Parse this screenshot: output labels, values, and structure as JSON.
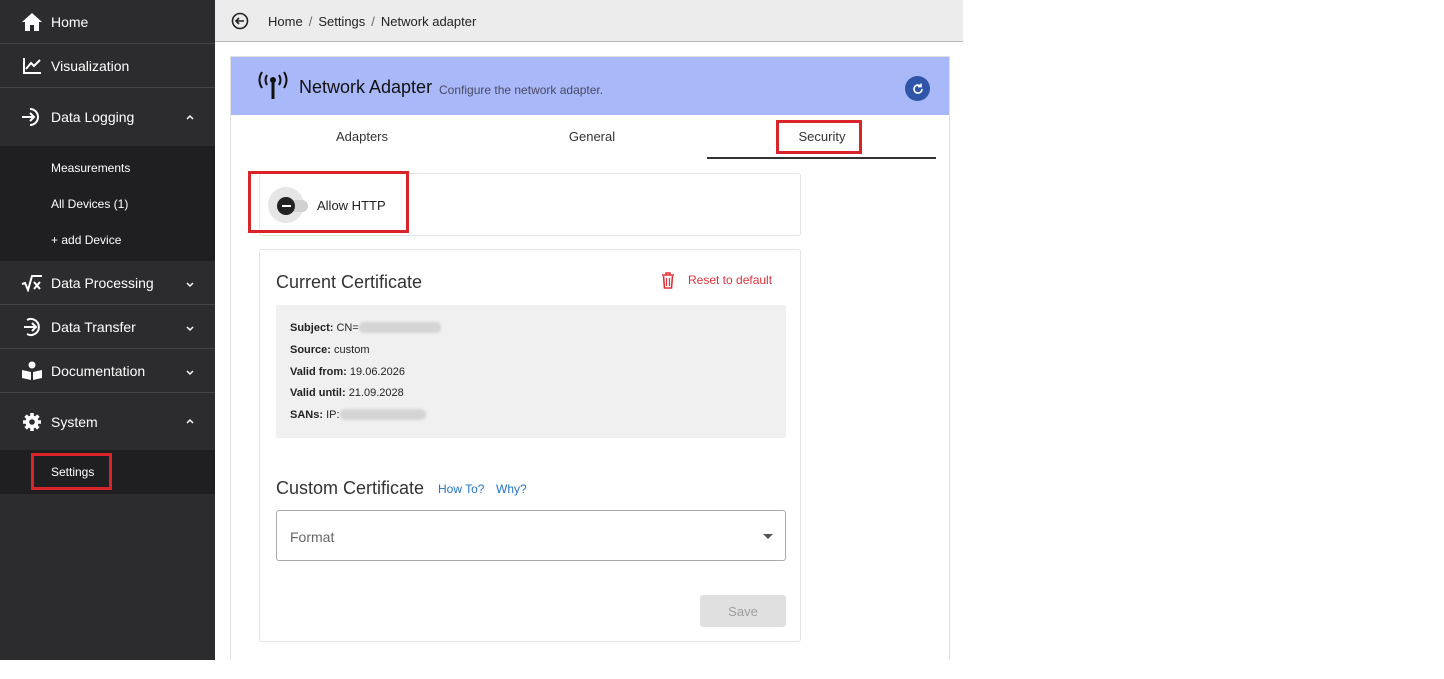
{
  "sidebar": {
    "items": [
      {
        "label": "Home",
        "icon": "home-icon"
      },
      {
        "label": "Visualization",
        "icon": "chart-line-icon"
      },
      {
        "label": "Data Logging",
        "icon": "login-arrow-icon",
        "expanded": true
      },
      {
        "label": "Data Processing",
        "icon": "sqrt-x-icon",
        "expanded": false
      },
      {
        "label": "Data Transfer",
        "icon": "arrow-circle-right-icon",
        "expanded": false
      },
      {
        "label": "Documentation",
        "icon": "reader-icon",
        "expanded": false
      },
      {
        "label": "System",
        "icon": "gear-icon",
        "expanded": true
      }
    ],
    "data_logging_sub": [
      "Measurements",
      "All Devices (1)",
      "+ add Device"
    ],
    "system_sub": [
      "Settings"
    ]
  },
  "breadcrumb": {
    "items": [
      "Home",
      "Settings",
      "Network adapter"
    ],
    "separator": "/"
  },
  "header": {
    "title": "Network Adapter",
    "subtitle": "Configure the network adapter.",
    "color": "#a8b8f8"
  },
  "tabs": [
    {
      "label": "Adapters"
    },
    {
      "label": "General"
    },
    {
      "label": "Security",
      "active": true
    }
  ],
  "http": {
    "label": "Allow HTTP",
    "enabled": false
  },
  "current_cert": {
    "title": "Current Certificate",
    "reset_label": "Reset to default",
    "subject_label": "Subject:",
    "subject_value": "CN=",
    "source_label": "Source:",
    "source_value": "custom",
    "valid_from_label": "Valid from:",
    "valid_from_value": "19.06.2026",
    "valid_until_label": "Valid until:",
    "valid_until_value": "21.09.2028",
    "sans_label": "SANs:",
    "sans_value": "IP:"
  },
  "custom_cert": {
    "title": "Custom Certificate",
    "howto_link": "How To?",
    "why_link": "Why?",
    "format_placeholder": "Format",
    "save_label": "Save"
  },
  "colors": {
    "highlight": "#d9242a",
    "accent": "#2f54a8",
    "danger": "#e2323a",
    "link": "#2474c9"
  }
}
